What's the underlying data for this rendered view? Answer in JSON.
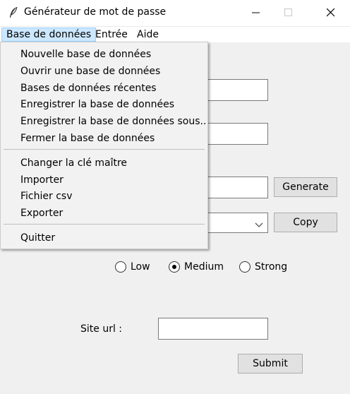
{
  "window": {
    "title": "Générateur de mot de passe",
    "controls": [
      "minimize",
      "maximize",
      "close"
    ]
  },
  "menubar": {
    "items": [
      "Base de données",
      "Entrée",
      "Aide"
    ],
    "active": "Base de données"
  },
  "dropdown": {
    "groups": [
      [
        "Nouvelle base de données",
        "Ouvrir une base de données",
        "Bases de données récentes",
        "Enregistrer la base de données",
        "Enregistrer la base de données sous..",
        "Fermer la base de données"
      ],
      [
        "Changer la clé maître",
        "Importer",
        "Fichier csv",
        "Exporter"
      ],
      [
        "Quitter"
      ]
    ]
  },
  "form": {
    "entry1_value": "",
    "entry2_value": "",
    "password_value": "",
    "generate_label": "Generate",
    "combo_value": "",
    "copy_label": "Copy",
    "strength_options": [
      "Low",
      "Medium",
      "Strong"
    ],
    "strength_selected": "Medium",
    "site_url_label": "Site url :",
    "site_url_value": "",
    "submit_label": "Submit"
  },
  "icons": [
    "feather-icon",
    "minimize-icon",
    "maximize-icon",
    "close-icon",
    "chevron-down-icon"
  ],
  "colors": {
    "menu_highlight": "#cce8ff",
    "menu_highlight_border": "#99d1ff"
  }
}
